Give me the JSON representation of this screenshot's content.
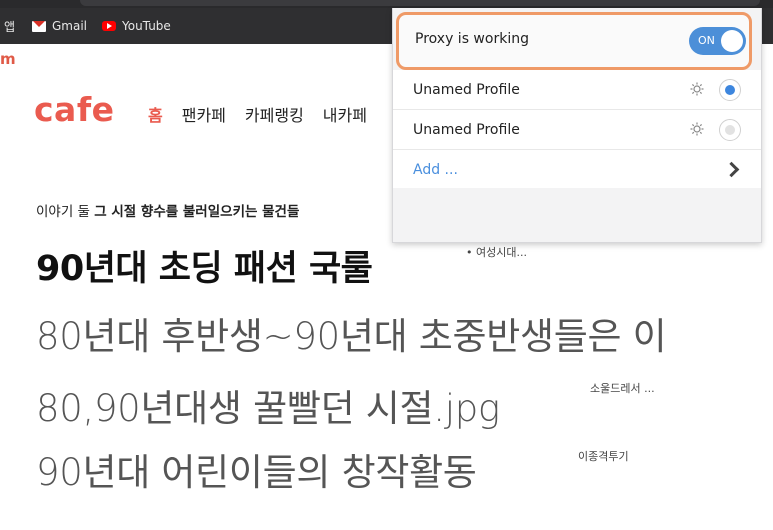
{
  "browser": {
    "bookmarks": [
      {
        "label": "앱"
      },
      {
        "label": "Gmail"
      },
      {
        "label": "YouTube"
      }
    ]
  },
  "page": {
    "brand_edge": "m",
    "logo": "cafe",
    "nav": [
      "홈",
      "팬카페",
      "카페랭킹",
      "내카페"
    ],
    "subtitle_prefix": "이야기 둘 ",
    "subtitle_bold": "그 시절 향수를 불러일으키는 물건들",
    "headline": "90년대 초딩 패션 국룰",
    "headline_source": "• 여성시대...",
    "rows": [
      {
        "title": "80년대 후반생~90년대 초중반생들은 이"
      },
      {
        "title": "80,90년대생 꿀빨던 시절.jpg",
        "source": "소울드레서 ..."
      },
      {
        "title": "90년대 어린이들의 창작활동",
        "source": "이종격투기"
      }
    ]
  },
  "popup": {
    "status": "Proxy is working",
    "toggle": "ON",
    "profiles": [
      {
        "label": "Unamed Profile",
        "selected": true
      },
      {
        "label": "Unamed Profile",
        "selected": false
      }
    ],
    "add_label": "Add ..."
  },
  "colors": {
    "brand": "#ea5b4f",
    "toggle": "#4c8fd8",
    "status_border": "#ef9a67"
  }
}
